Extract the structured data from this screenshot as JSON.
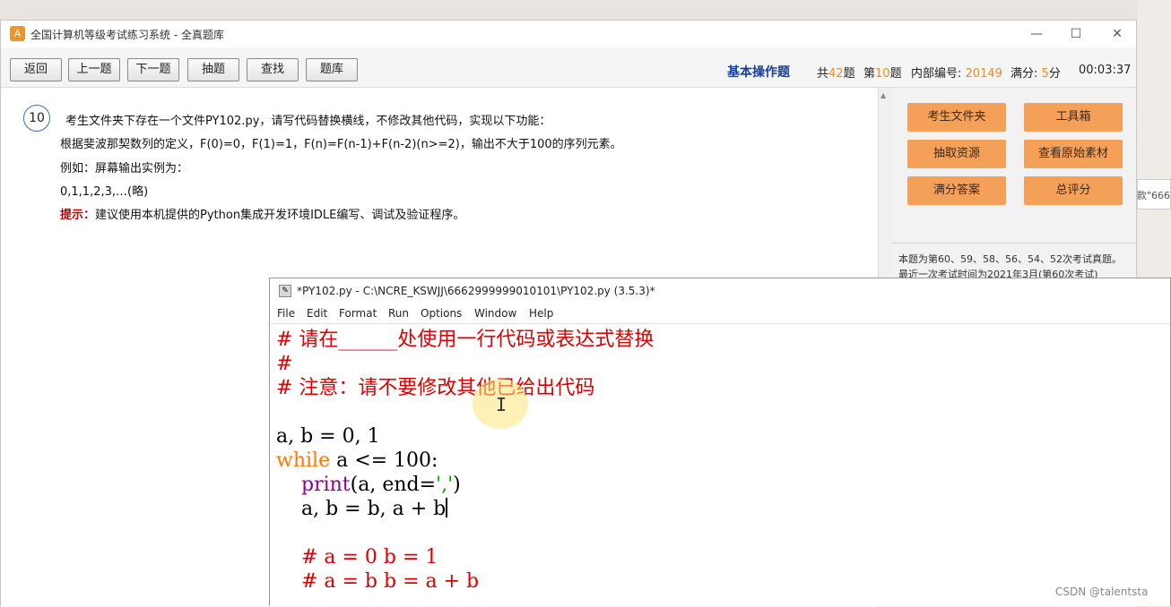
{
  "window": {
    "title": "全国计算机等级考试练习系统 - 全真题库",
    "icon": "A",
    "min_icon": "—",
    "max_icon": "☐",
    "close_icon": "✕"
  },
  "toolbar": {
    "buttons": [
      "返回",
      "上一题",
      "下一题",
      "抽题",
      "查找",
      "题库"
    ],
    "question_type": "基本操作题",
    "total_label_pre": "共",
    "total_count": "42",
    "total_label_post": "题",
    "current_label_pre": "第",
    "current_index": "10",
    "current_label_post": "题",
    "internal_id_label": "内部编号:",
    "internal_id": "20149",
    "score_label": "满分:",
    "score": "5",
    "score_unit": "分",
    "timer": "00:03:37"
  },
  "question": {
    "number": "10",
    "line1": "考生文件夹下存在一个文件PY102.py，请写代码替换横线，不修改其他代码，实现以下功能：",
    "line2": "根据斐波那契数列的定义，F(0)=0，F(1)=1，F(n)=F(n-1)+F(n-2)(n>=2)，输出不大于100的序列元素。",
    "line3": "例如：屏幕输出实例为：",
    "line4": "0,1,1,2,3,…(略)",
    "hint_label": "提示：",
    "hint_text": "建议使用本机提供的Python集成开发环境IDLE编写、调试及验证程序。"
  },
  "side_panel": {
    "buttons": [
      "考生文件夹",
      "工具箱",
      "抽取资源",
      "查看原始素材",
      "满分答案",
      "总评分"
    ],
    "note": "本题为第60、59、58、56、54、52次考试真题。最近一次考试时间为2021年3月(第60次考试)"
  },
  "peek_text": "款\"6662",
  "idle": {
    "title": "*PY102.py - C:\\NCRE_KSWJJ\\6662999999010101\\PY102.py (3.5.3)*",
    "menu": [
      "File",
      "Edit",
      "Format",
      "Run",
      "Options",
      "Window",
      "Help"
    ],
    "code": {
      "l1": "# 请在______处使用一行代码或表达式替换",
      "l2": "#",
      "l3": "# 注意：请不要修改其他已给出代码",
      "l5": "a, b = 0, 1",
      "l6_kw": "while",
      "l6_rest": " a <= 100:",
      "l7_indent": "    ",
      "l7_builtin": "print",
      "l7_a": "(a, end=",
      "l7_str": "','",
      "l7_b": ")",
      "l8": "    a, b = b, a + b",
      "l10": "    # a = 0 b = 1",
      "l11": "    # a = b b = a + b"
    }
  },
  "watermark": "CSDN @talentsta"
}
